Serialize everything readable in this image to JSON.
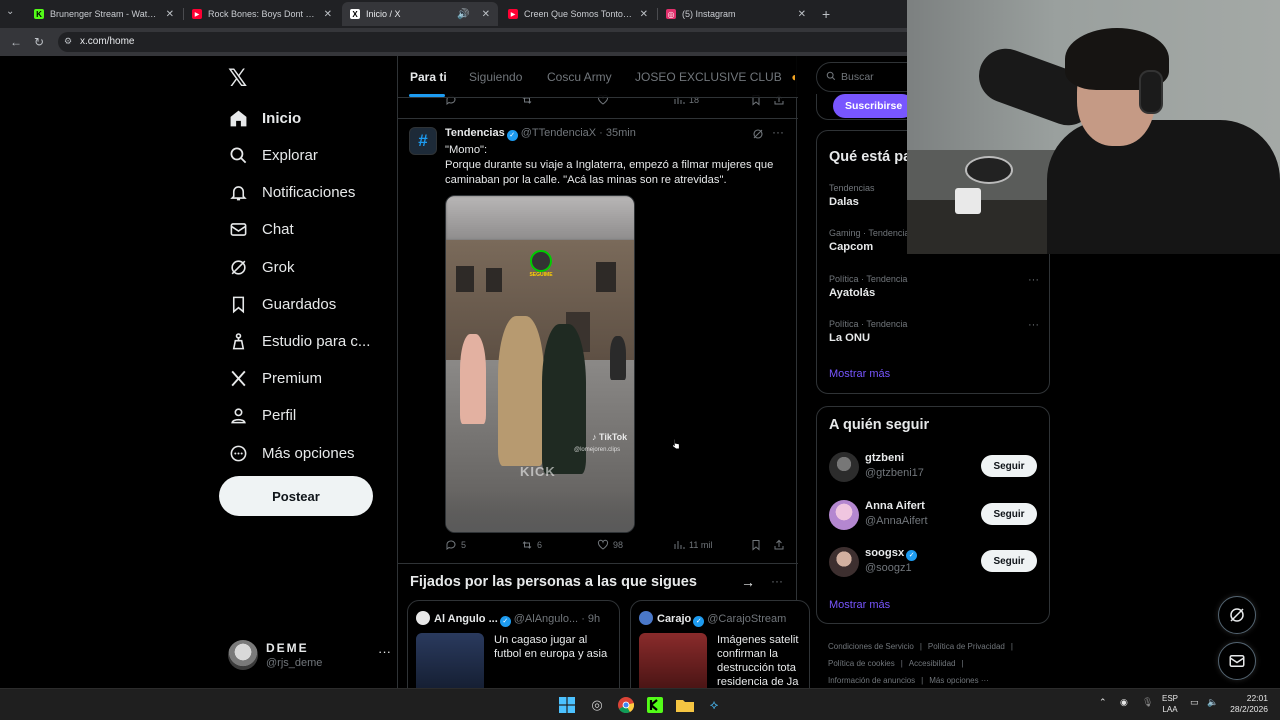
{
  "browser": {
    "tabs": [
      {
        "title": "Brunenger Stream - Watch Live",
        "fav_color": "#53fc18",
        "fav_glyph": "K"
      },
      {
        "title": "Rock Bones: Boys Dont Cry - Pe",
        "fav_color": "#ff0033",
        "fav_glyph": "▶"
      },
      {
        "title": "Inicio / X",
        "fav_color": "#ffffff",
        "fav_glyph": "X"
      },
      {
        "title": "Creen Que Somos Tontos - You",
        "fav_color": "#ff0033",
        "fav_glyph": "▶"
      },
      {
        "title": "(5) Instagram",
        "fav_color": "#e1306c",
        "fav_glyph": "◎"
      }
    ],
    "url": "x.com/home"
  },
  "nav": {
    "items": [
      {
        "label": "Inicio",
        "icon": "home-icon"
      },
      {
        "label": "Explorar",
        "icon": "search-icon"
      },
      {
        "label": "Notificaciones",
        "icon": "bell-icon"
      },
      {
        "label": "Chat",
        "icon": "mail-icon"
      },
      {
        "label": "Grok",
        "icon": "grok-icon"
      },
      {
        "label": "Guardados",
        "icon": "bookmark-icon"
      },
      {
        "label": "Estudio para c...",
        "icon": "studio-icon"
      },
      {
        "label": "Premium",
        "icon": "x-icon"
      },
      {
        "label": "Perfil",
        "icon": "person-icon"
      },
      {
        "label": "Más opciones",
        "icon": "more-circle-icon"
      }
    ],
    "post_label": "Postear",
    "profile": {
      "name": "DEME",
      "handle": "@rjs_deme",
      "more": "···"
    }
  },
  "feed": {
    "tabs": [
      "Para ti",
      "Siguiendo",
      "Coscu Army",
      "JOSEO EXCLUSIVE CLUB"
    ],
    "prev_tweet_views": "18",
    "tweet": {
      "avatar_glyph": "#",
      "name": "Tendencias",
      "handle": "@TTendenciaX",
      "time": "· 35min",
      "more": "···",
      "text": "\"Momo\":\nPorque durante su viaje a Inglaterra, empezó a filmar mujeres que caminaban por la calle. \"Acá las minas son re atrevidas\".",
      "video_watermark_kick": "KICK",
      "video_watermark_tiktok": "♪ TikTok",
      "video_tiktok_user": "@lomejoren.clips",
      "replies": "5",
      "reposts": "6",
      "likes": "98",
      "views": "11 mil"
    },
    "pinned_section": {
      "title": "Fijados por las personas a las que sigues",
      "arrow": "→",
      "more": "···",
      "cards": [
        {
          "name": "Al Angulo ...",
          "handle": "@AlAngulo...",
          "time": "· 9h",
          "text": "Un cagaso jugar al futbol en europa y asia",
          "avatar_color": "#e8e8e8",
          "thumb_color": "#1b2a4a"
        },
        {
          "name": "Carajo",
          "handle": "@CarajoStream",
          "time": "",
          "text": "Imágenes satelit confirman la destrucción tota residencia de Ja",
          "avatar_color": "#4a78c8",
          "thumb_color": "#7a1a1a"
        }
      ]
    }
  },
  "sidebar": {
    "search_placeholder": "Buscar",
    "subscribe_label": "Suscribirse",
    "trends_title": "Qué está pa",
    "trends": [
      {
        "meta": "Tendencias",
        "name": "Dalas"
      },
      {
        "meta": "Gaming · Tendencia",
        "name": "Capcom"
      },
      {
        "meta": "Política · Tendencia",
        "name": "Ayatolás"
      },
      {
        "meta": "Política · Tendencia",
        "name": "La ONU"
      }
    ],
    "trend_more": "···",
    "show_more": "Mostrar más",
    "follow_title": "A quién seguir",
    "follow": [
      {
        "name": "gtzbeni",
        "handle": "@gtzbeni17",
        "button": "Seguir",
        "verified": false,
        "avatar_color": "#3a3a3a"
      },
      {
        "name": "Anna Aifert",
        "handle": "@AnnaAifert",
        "button": "Seguir",
        "verified": false,
        "avatar_color": "#c69ad6"
      },
      {
        "name": "soogsx",
        "handle": "@soogz1",
        "button": "Seguir",
        "verified": true,
        "avatar_color": "#4a3a3a"
      }
    ],
    "follow_show_more": "Mostrar más",
    "footer": [
      "Condiciones de Servicio",
      "Política de Privacidad",
      "Política de cookies",
      "Accesibilidad",
      "Información de anuncios",
      "Más opciones ···"
    ]
  },
  "taskbar": {
    "lang_top": "ESP",
    "lang_bottom": "LAA",
    "time": "22:01",
    "date": "28/2/2026"
  },
  "colors": {
    "accent_blue": "#1d9bf0",
    "accent_purple": "#7856ff",
    "border": "#2f3336",
    "muted": "#71767b"
  }
}
